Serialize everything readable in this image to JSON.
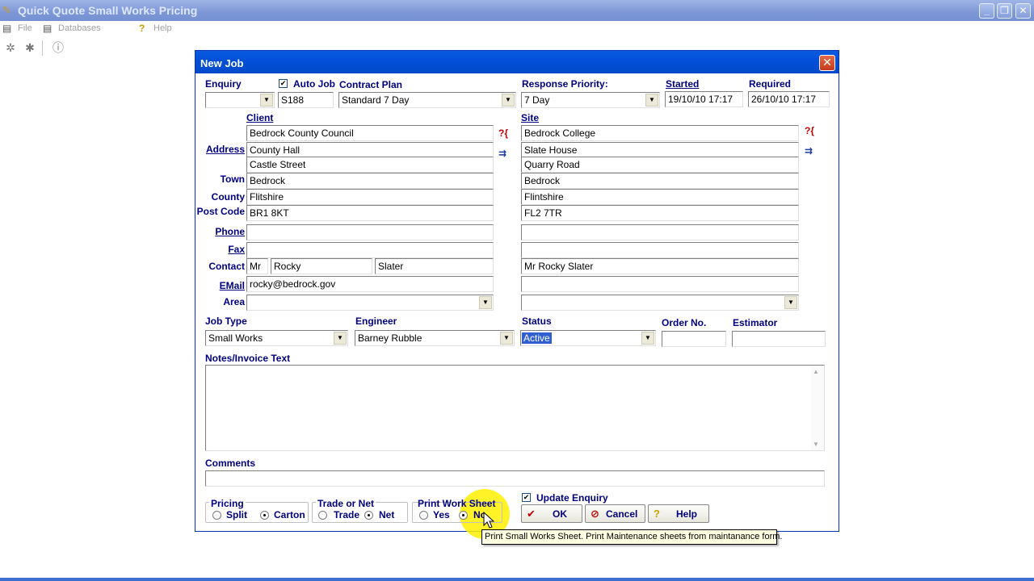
{
  "app": {
    "title": "Quick Quote Small Works Pricing",
    "window_controls": {
      "minimize": "_",
      "maximize": "❐",
      "close": "✕"
    }
  },
  "menu": [
    {
      "label": "File",
      "icon": "file-db-icon"
    },
    {
      "label": "Databases",
      "icon": "database-icon"
    },
    {
      "label": "Help",
      "icon": "help-icon"
    }
  ],
  "toolbar": {
    "buttons": [
      "new-icon",
      "settings-icon",
      "help-icon"
    ]
  },
  "dialog": {
    "title": "New Job",
    "labels": {
      "enquiry": "Enquiry",
      "auto_job": "Auto Job",
      "contract_plan": "Contract Plan",
      "response_priority": "Response Priority:",
      "started": "Started",
      "required": "Required",
      "client": "Client",
      "site": "Site",
      "address": "Address",
      "town": "Town",
      "county": "County",
      "post_code": "Post Code",
      "phone": "Phone",
      "fax": "Fax",
      "contact": "Contact",
      "email": "EMail",
      "area": "Area",
      "job_type": "Job Type",
      "engineer": "Engineer",
      "status": "Status",
      "order_no": "Order No.",
      "estimator": "Estimator",
      "notes": "Notes/Invoice Text",
      "comments": "Comments"
    },
    "values": {
      "enquiry": "",
      "auto_job_checked": true,
      "job_no": "S188",
      "contract_plan": "Standard 7 Day",
      "response_priority": "7 Day",
      "started": "19/10/10 17:17",
      "required": "26/10/10 17:17",
      "client": {
        "name": "Bedrock County Council",
        "address1": "County Hall",
        "address2": "Castle Street",
        "town": "Bedrock",
        "county": "Flitshire",
        "post_code": "BR1 8KT",
        "phone": "",
        "fax": "",
        "contact_title": "Mr",
        "contact_first": "Rocky",
        "contact_last": "Slater",
        "email": "rocky@bedrock.gov",
        "area": ""
      },
      "site": {
        "name": "Bedrock College",
        "address1": "Slate House",
        "address2": "Quarry Road",
        "town": "Bedrock",
        "county": "Flintshire",
        "post_code": "FL2 7TR",
        "phone": "",
        "fax": "",
        "contact": "Mr Rocky Slater",
        "email": "",
        "area": ""
      },
      "job_type": "Small Works",
      "engineer": "Barney Rubble",
      "status": "Active",
      "order_no": "",
      "estimator": "",
      "notes": "",
      "comments": ""
    },
    "pricing": {
      "title": "Pricing",
      "options": [
        "Split",
        "Carton"
      ],
      "selected": "Carton"
    },
    "trade_or_net": {
      "title": "Trade or Net",
      "options": [
        "Trade",
        "Net"
      ],
      "selected": "Net"
    },
    "print_work_sheet": {
      "title": "Print Work Sheet",
      "options": [
        "Yes",
        "No"
      ],
      "selected": "No"
    },
    "update_enquiry": {
      "label": "Update Enquiry",
      "checked": true
    },
    "buttons": {
      "ok": "OK",
      "cancel": "Cancel",
      "help": "Help"
    },
    "tooltip": "Print Small Works  Sheet. Print Maintenance sheets from maintanance form."
  },
  "colors": {
    "label_blue": "#000080",
    "title_blue": "#0350d8",
    "highlight": "#fff000"
  }
}
